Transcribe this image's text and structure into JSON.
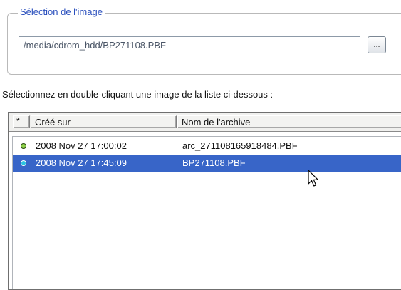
{
  "image_selection": {
    "group_title": "Sélection de l'image",
    "path_value": "/media/cdrom_hdd/BP271108.PBF",
    "browse_label": "..."
  },
  "instruction": "Sélectionnez en double-cliquant une image de la liste ci-dessous :",
  "list": {
    "columns": [
      "*",
      "Créé sur",
      "Nom de l'archive"
    ],
    "rows": [
      {
        "date": "2008 Nov 27 17:00:02",
        "name": "arc_271108165918484.PBF",
        "status": "green-dot",
        "selected": false
      },
      {
        "date": "2008 Nov 27 17:45:09",
        "name": "BP271108.PBF",
        "status": "cyan-dot",
        "selected": true
      }
    ]
  },
  "colors": {
    "group_title": "#2a4fbd",
    "selection": "#3865c8"
  }
}
